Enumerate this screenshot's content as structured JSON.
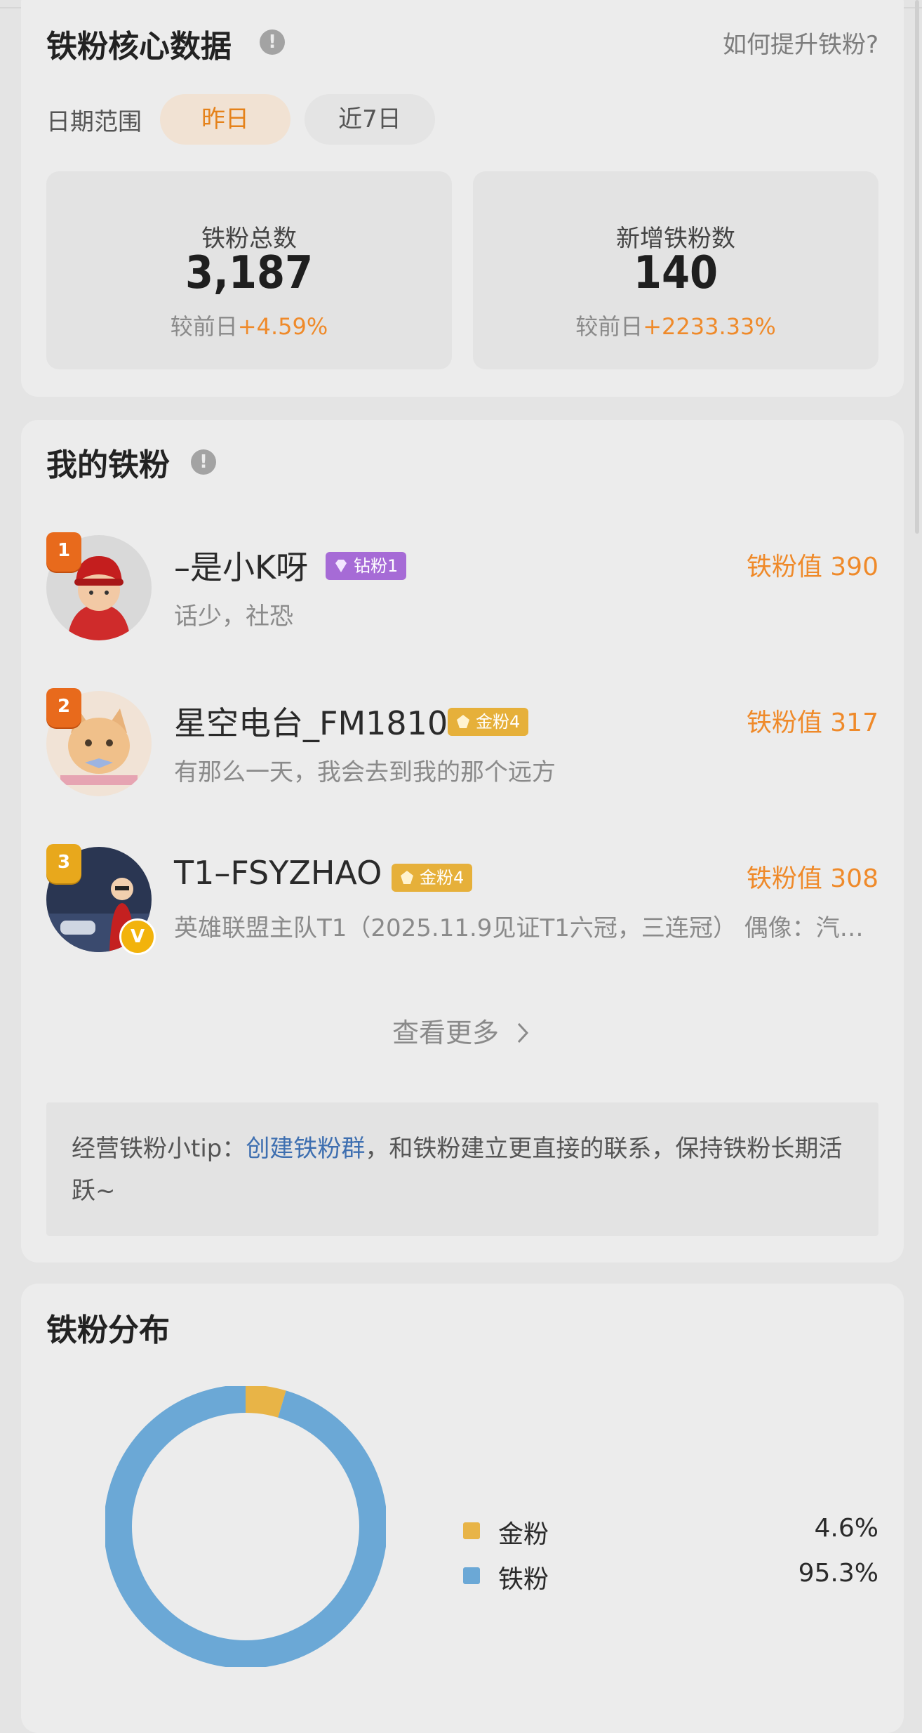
{
  "core": {
    "title": "铁粉核心数据",
    "info_icon": "!",
    "help_link": "如何提升铁粉?",
    "date_label": "日期范围",
    "date_options": [
      "昨日",
      "近7日"
    ],
    "stats": [
      {
        "label": "铁粉总数",
        "value": "3,187",
        "change_prefix": "较前日",
        "change": "+4.59%"
      },
      {
        "label": "新增铁粉数",
        "value": "140",
        "change_prefix": "较前日",
        "change": "+2233.33%"
      }
    ]
  },
  "my_fans": {
    "title": "我的铁粉",
    "info_icon": "!",
    "fans": [
      {
        "rank": "1",
        "name": "–是小K呀",
        "tag": "钻粉1",
        "tag_type": "diamond",
        "score": "铁粉值 390",
        "bio": "话少，社恐",
        "verified": ""
      },
      {
        "rank": "2",
        "name": "星空电台_FM1810",
        "tag": "金粉4",
        "tag_type": "gold",
        "score": "铁粉值 317",
        "bio": "有那么一天，我会去到我的那个远方",
        "verified": ""
      },
      {
        "rank": "3",
        "name": "T1–FSYZHAO",
        "tag": "金粉4",
        "tag_type": "gold",
        "score": "铁粉值 308",
        "bio": "英雄联盟主队T1（2025.11.9见证T1六冠，三连冠） 偶像：汽…",
        "verified": "V"
      }
    ],
    "see_more": "查看更多",
    "see_more_icon": "chevron-right-icon",
    "tip_prefix": "经营铁粉小tip：",
    "tip_link": "创建铁粉群",
    "tip_suffix": "，和铁粉建立更直接的联系，保持铁粉长期活跃~"
  },
  "distribution": {
    "title": "铁粉分布",
    "chart_data": {
      "type": "pie",
      "categories": [
        "金粉",
        "铁粉"
      ],
      "values": [
        4.6,
        95.3
      ],
      "labels": [
        "4.6%",
        "95.3%"
      ],
      "colors": [
        "#e8b447",
        "#6ba8d6"
      ]
    }
  },
  "colors": {
    "accent": "#ef8a2a",
    "link": "#3e6fb0",
    "gold": "#e8b447",
    "blue": "#6ba8d6",
    "diamond": "#a66bd6"
  }
}
